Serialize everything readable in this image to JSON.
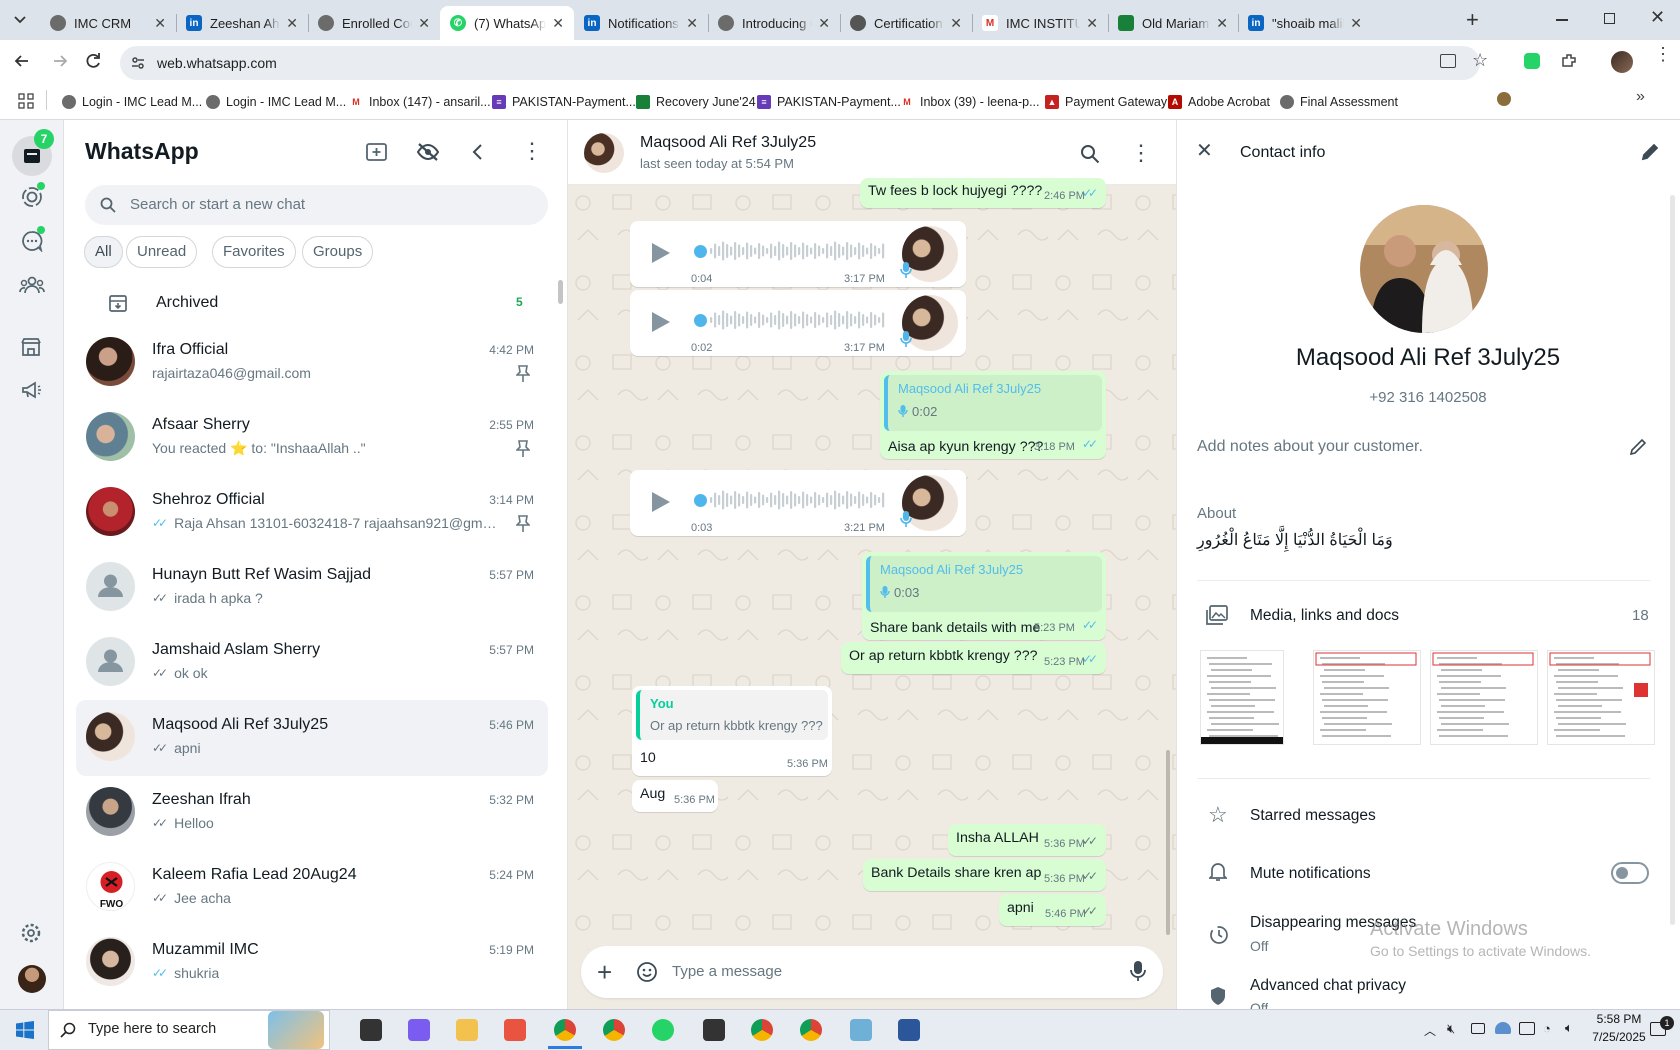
{
  "browser": {
    "tabs": [
      {
        "label": "IMC CRM",
        "fav": "crm",
        "active": false
      },
      {
        "label": "Zeeshan Ahm",
        "fav": "in",
        "active": false
      },
      {
        "label": "Enrolled Cou",
        "fav": "crm",
        "active": false
      },
      {
        "label": "(7) WhatsApp",
        "fav": "wa",
        "active": true
      },
      {
        "label": "Notifications",
        "fav": "in",
        "active": false
      },
      {
        "label": "Introducing C",
        "fav": "crm",
        "active": false
      },
      {
        "label": "Certification",
        "fav": "chat",
        "active": false
      },
      {
        "label": "IMC INSTITU",
        "fav": "gm",
        "active": false
      },
      {
        "label": "Old Mariam 2",
        "fav": "sheet",
        "active": false
      },
      {
        "label": "\"shoaib malik",
        "fav": "in",
        "active": false
      }
    ],
    "url": "web.whatsapp.com",
    "bookmarks": [
      {
        "label": "Login - IMC Lead M...",
        "fav": "crm"
      },
      {
        "label": "Login - IMC Lead M...",
        "fav": "crm"
      },
      {
        "label": "Inbox (147) - ansaril...",
        "fav": "gm"
      },
      {
        "label": "PAKISTAN-Payment...",
        "fav": "form"
      },
      {
        "label": "Recovery June'24",
        "fav": "sheet"
      },
      {
        "label": "PAKISTAN-Payment...",
        "fav": "form"
      },
      {
        "label": "Inbox (39) - leena-p...",
        "fav": "gm"
      },
      {
        "label": "Payment Gateway",
        "fav": "pdf"
      },
      {
        "label": "Adobe Acrobat",
        "fav": "acro"
      },
      {
        "label": "Final Assessment",
        "fav": "crm"
      }
    ]
  },
  "rail": {
    "badge": "7"
  },
  "chatlist": {
    "title": "WhatsApp",
    "search_placeholder": "Search or start a new chat",
    "filters": [
      "All",
      "Unread",
      "Favorites",
      "Groups"
    ],
    "archived_label": "Archived",
    "archived_count": "5",
    "chats": [
      {
        "name": "Ifra Official",
        "time": "4:42 PM",
        "preview": "rajairtaza046@gmail.com",
        "ticks": "",
        "pinned": true,
        "avatar": "photo1"
      },
      {
        "name": "Afsaar Sherry",
        "time": "2:55 PM",
        "preview": "You reacted ⭐ to: \"InshaaAllah ..\"",
        "ticks": "",
        "pinned": true,
        "avatar": "photo2"
      },
      {
        "name": "Shehroz Official",
        "time": "3:14 PM",
        "preview": "Raja Ahsan 13101-6032418-7 rajaahsan921@gmail....",
        "ticks": "blue",
        "pinned": true,
        "avatar": "photo3"
      },
      {
        "name": "Hunayn Butt Ref Wasim Sajjad",
        "time": "5:57 PM",
        "preview": "irada h apka ?",
        "ticks": "grey",
        "pinned": false,
        "avatar": "default"
      },
      {
        "name": "Jamshaid Aslam Sherry",
        "time": "5:57 PM",
        "preview": "ok ok",
        "ticks": "grey",
        "pinned": false,
        "avatar": "default"
      },
      {
        "name": "Maqsood Ali Ref 3July25",
        "time": "5:46 PM",
        "preview": "apni",
        "ticks": "grey",
        "pinned": false,
        "avatar": "photo4",
        "selected": true
      },
      {
        "name": "Zeeshan Ifrah",
        "time": "5:32 PM",
        "preview": "Helloo",
        "ticks": "grey",
        "pinned": false,
        "avatar": "photo5"
      },
      {
        "name": "Kaleem Rafia Lead 20Aug24",
        "time": "5:24 PM",
        "preview": "Jee acha",
        "ticks": "grey",
        "pinned": false,
        "avatar": "fwo"
      },
      {
        "name": "Muzammil IMC",
        "time": "5:19 PM",
        "preview": "shukria",
        "ticks": "blue",
        "pinned": false,
        "avatar": "photo6"
      }
    ]
  },
  "conversation": {
    "name": "Maqsood Ali Ref 3July25",
    "status": "last seen today at 5:54 PM",
    "input_placeholder": "Type a message",
    "messages": {
      "m0_text": "Tw fees b lock hujyegi ????",
      "m0_time": "2:46 PM",
      "v1_dur": "0:04",
      "v1_time": "3:17 PM",
      "v2_dur": "0:02",
      "v2_time": "3:17 PM",
      "m3_qname": "Maqsood Ali Ref 3July25",
      "m3_qdur": "0:02",
      "m3_text": "Aisa ap kyun krengy ???",
      "m3_time": "3:18 PM",
      "v4_dur": "0:03",
      "v4_time": "3:21 PM",
      "m5_qname": "Maqsood Ali Ref 3July25",
      "m5_qdur": "0:03",
      "m5_text": "Share bank details with me",
      "m5_time": "5:23 PM",
      "m6_text": "Or ap return kbbtk krengy ???",
      "m6_time": "5:23 PM",
      "m7_qname": "You",
      "m7_qtext": "Or ap return kbbtk krengy ???",
      "m7_text": "10",
      "m7_time": "5:36 PM",
      "m8_text": "Aug",
      "m8_time": "5:36 PM",
      "m9_text": "Insha ALLAH",
      "m9_time": "5:36 PM",
      "m10_text": "Bank Details share kren ap",
      "m10_time": "5:36 PM",
      "m11_text": "apni",
      "m11_time": "5:46 PM"
    }
  },
  "contact": {
    "header": "Contact info",
    "name": "Maqsood Ali Ref 3July25",
    "phone": "+92 316 1402508",
    "notes_placeholder": "Add notes about your customer.",
    "about_label": "About",
    "about_text": "وَمَا الْحَيَاةُ الدُّنْيَا إِلَّا مَتَاعُ الْغُرُورِ",
    "media_label": "Media, links and docs",
    "media_count": "18",
    "starred": "Starred messages",
    "mute": "Mute notifications",
    "mute_on": false,
    "disappearing": "Disappearing messages",
    "disappearing_value": "Off",
    "privacy": "Advanced chat privacy",
    "privacy_value": "Off"
  },
  "watermark": {
    "line1": "Activate Windows",
    "line2": "Go to Settings to activate Windows."
  },
  "taskbar": {
    "search_placeholder": "Type here to search",
    "time": "5:58 PM",
    "date": "7/25/2025"
  }
}
